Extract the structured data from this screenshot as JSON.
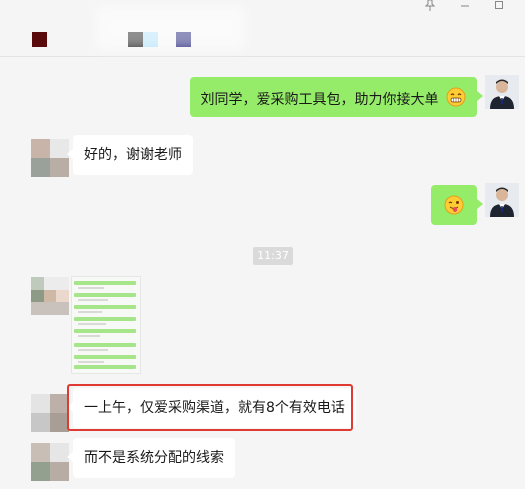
{
  "window": {
    "pin_icon": "pin-icon",
    "minimize_icon": "minimize-icon",
    "maximize_icon": "maximize-icon"
  },
  "messages": [
    {
      "side": "right",
      "text": "刘同学，爱采购工具包，助力你接大单",
      "emoji": "grin"
    },
    {
      "side": "left",
      "text": "好的，谢谢老师"
    },
    {
      "side": "right",
      "emoji": "wink-tongue"
    },
    {
      "side": "center",
      "time": "11:37"
    },
    {
      "side": "left",
      "image": "screenshot-thumbnail"
    },
    {
      "side": "left",
      "text": "一上午，仅爱采购渠道，就有8个有效电话",
      "highlighted": true
    },
    {
      "side": "left",
      "text": "而不是系统分配的线索"
    }
  ],
  "colors": {
    "green_bubble": "#95ec69",
    "white_bubble": "#ffffff",
    "background": "#f5f5f5",
    "highlight": "#e03a33"
  }
}
